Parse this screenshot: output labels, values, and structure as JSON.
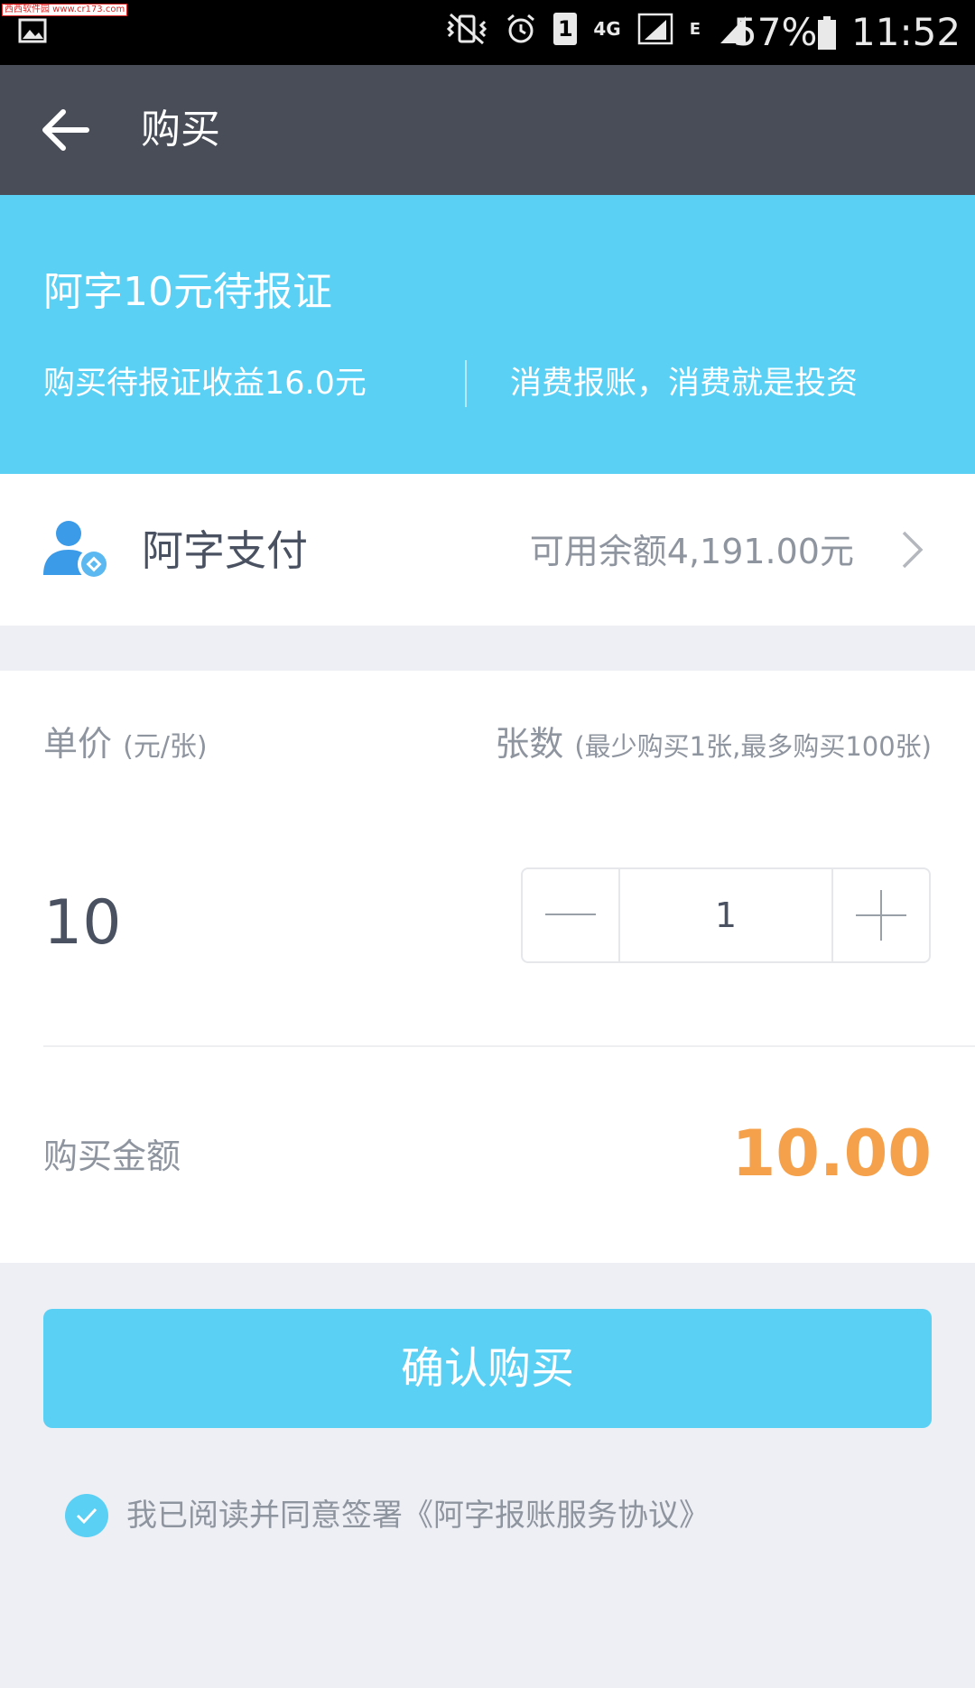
{
  "status_bar": {
    "watermark": "西西软件园 www.cr173.com",
    "battery": "57%",
    "time": "11:52",
    "sim_slot": "1",
    "network": "4G",
    "network_secondary": "E",
    "icons": [
      "gallery-icon",
      "mute-vibrate-icon",
      "alarm-icon",
      "sim-icon",
      "signal-icon",
      "battery-icon"
    ]
  },
  "app_bar": {
    "title": "购买"
  },
  "banner": {
    "product_name": "阿字10元待报证",
    "income_text": "购买待报证收益16.0元",
    "slogan": "消费报账，消费就是投资"
  },
  "payment": {
    "method": "阿字支付",
    "balance": "可用余额4,191.00元"
  },
  "purchase": {
    "unit_price_label": "单价",
    "unit_price_unit": "(元/张)",
    "count_label": "张数",
    "count_hint": "(最少购买1张,最多购买100张)",
    "unit_price": "10",
    "quantity": "1",
    "amount_label": "购买金额",
    "amount": "10.00"
  },
  "confirm_label": "确认购买",
  "agreement": {
    "checked": true,
    "text": "我已阅读并同意签署《阿字报账服务协议》"
  },
  "colors": {
    "accent": "#5bd0f5",
    "app_bar": "#484d57",
    "amount": "#f5a04a",
    "background": "#eeeff5"
  }
}
